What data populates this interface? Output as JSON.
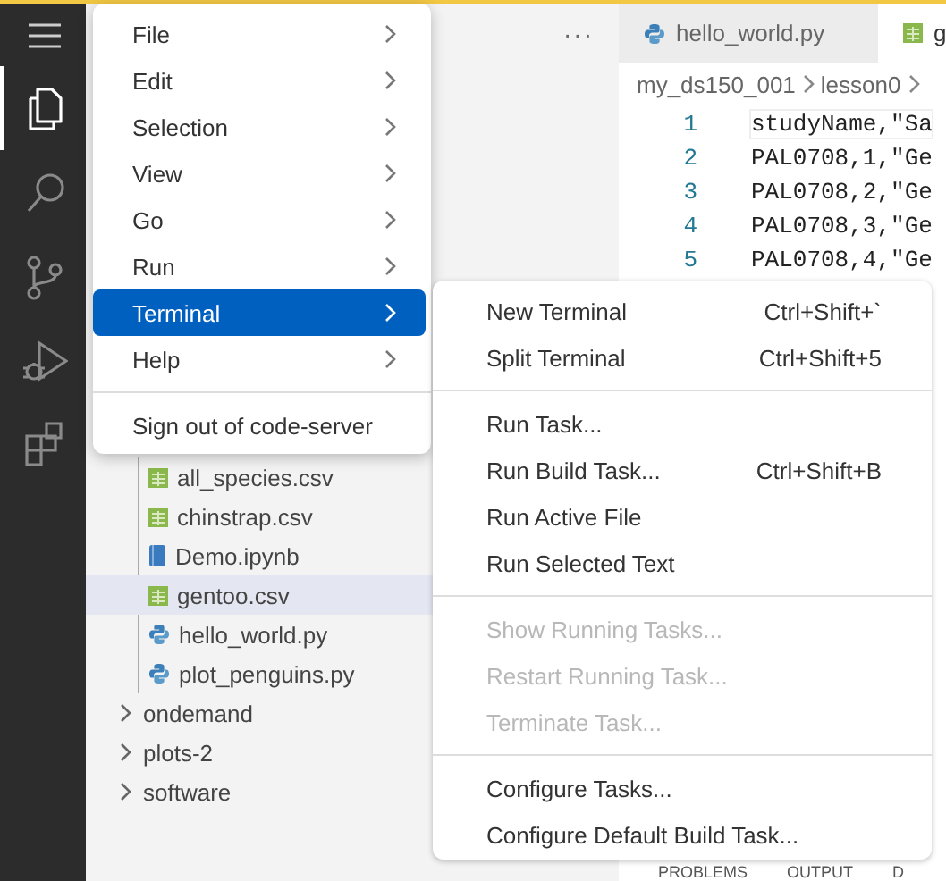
{
  "activity_bar": {
    "items": [
      {
        "kind": "menu"
      },
      {
        "kind": "explorer",
        "selected": true
      },
      {
        "kind": "search",
        "selected": false
      },
      {
        "kind": "source-control",
        "selected": false
      },
      {
        "kind": "debug",
        "selected": false
      },
      {
        "kind": "extensions",
        "selected": false
      }
    ]
  },
  "explorer": {
    "more": "···",
    "tree": [
      {
        "kind": "folder",
        "children": [
          {
            "name": "all_species.csv",
            "kind": "csv",
            "selected": false
          },
          {
            "name": "chinstrap.csv",
            "kind": "csv",
            "selected": false
          },
          {
            "name": "Demo.ipynb",
            "kind": "notebook",
            "selected": false
          },
          {
            "name": "gentoo.csv",
            "kind": "csv",
            "selected": true
          },
          {
            "name": "hello_world.py",
            "kind": "python",
            "selected": false
          },
          {
            "name": "plot_penguins.py",
            "kind": "python",
            "selected": false
          }
        ]
      },
      {
        "name": "ondemand",
        "kind": "folder",
        "expanded": false
      },
      {
        "name": "plots-2",
        "kind": "folder",
        "expanded": false
      },
      {
        "name": "software",
        "kind": "folder",
        "expanded": false
      }
    ]
  },
  "tabs": [
    {
      "label": "hello_world.py",
      "kind": "python",
      "selected": false
    },
    {
      "label": "g",
      "kind": "csv",
      "selected": true
    }
  ],
  "breadcrumb": [
    "my_ds150_001",
    "lesson0"
  ],
  "editor": {
    "lines": [
      {
        "number": "1",
        "text": "studyName,\"Sa",
        "current": true
      },
      {
        "number": "2",
        "text": "PAL0708,1,\"Ge",
        "current": false
      },
      {
        "number": "3",
        "text": "PAL0708,2,\"Ge",
        "current": false
      },
      {
        "number": "4",
        "text": "PAL0708,3,\"Ge",
        "current": false
      },
      {
        "number": "5",
        "text": "PAL0708,4,\"Ge",
        "current": false
      }
    ]
  },
  "panel": {
    "tabs": [
      {
        "label": "PROBLEMS"
      },
      {
        "label": "OUTPUT"
      },
      {
        "label": "D"
      }
    ]
  },
  "menu": {
    "groups": [
      [
        {
          "label": "File",
          "selected": false,
          "submenu": true
        },
        {
          "label": "Edit",
          "selected": false,
          "submenu": true
        },
        {
          "label": "Selection",
          "selected": false,
          "submenu": true
        },
        {
          "label": "View",
          "selected": false,
          "submenu": true
        },
        {
          "label": "Go",
          "selected": false,
          "submenu": true
        },
        {
          "label": "Run",
          "selected": false,
          "submenu": true
        },
        {
          "label": "Terminal",
          "selected": true,
          "submenu": true
        },
        {
          "label": "Help",
          "selected": false,
          "submenu": true
        }
      ],
      [
        {
          "label": "Sign out of code-server",
          "selected": false,
          "submenu": false
        }
      ]
    ]
  },
  "submenu": {
    "groups": [
      [
        {
          "label": "New Terminal",
          "shortcut": "Ctrl+Shift+`",
          "disabled": false
        },
        {
          "label": "Split Terminal",
          "shortcut": "Ctrl+Shift+5",
          "disabled": false
        }
      ],
      [
        {
          "label": "Run Task...",
          "disabled": false
        },
        {
          "label": "Run Build Task...",
          "shortcut": "Ctrl+Shift+B",
          "disabled": false
        },
        {
          "label": "Run Active File",
          "disabled": false
        },
        {
          "label": "Run Selected Text",
          "disabled": false
        }
      ],
      [
        {
          "label": "Show Running Tasks...",
          "disabled": true
        },
        {
          "label": "Restart Running Task...",
          "disabled": true
        },
        {
          "label": "Terminate Task...",
          "disabled": true
        }
      ],
      [
        {
          "label": "Configure Tasks...",
          "disabled": false
        },
        {
          "label": "Configure Default Build Task...",
          "disabled": false
        }
      ]
    ]
  }
}
